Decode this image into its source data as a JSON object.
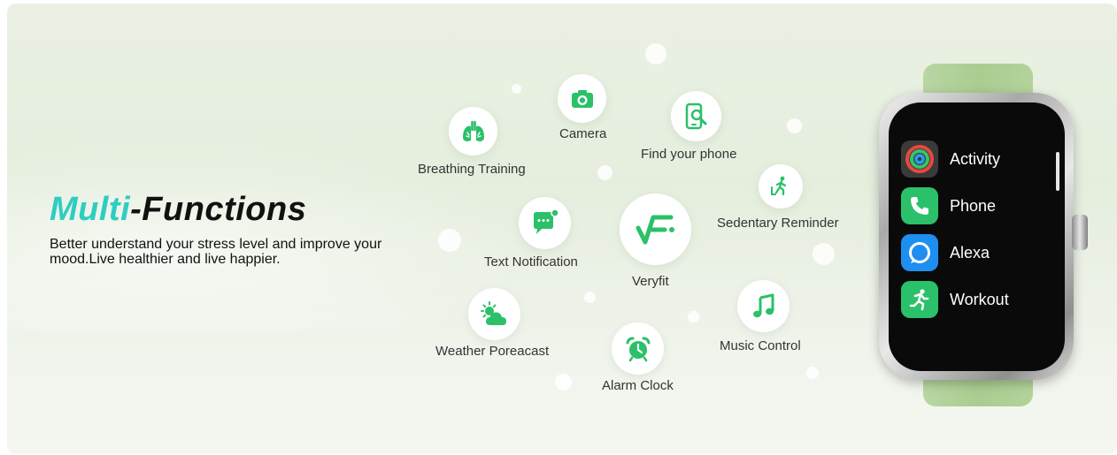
{
  "headline": {
    "part1": "Multi",
    "part2": "-Functions"
  },
  "description": "Better understand your stress level and improve your mood.Live healthier and live happier.",
  "features": {
    "breathing": "Breathing Training",
    "camera": "Camera",
    "find_phone": "Find your phone",
    "sedentary": "Sedentary Reminder",
    "text_notification": "Text Notification",
    "veryfit": "Veryfit",
    "weather": "Weather Poreacast",
    "alarm": "Alarm Clock",
    "music": "Music Control"
  },
  "watch": {
    "apps": [
      {
        "label": "Activity",
        "icon": "activity-rings-icon"
      },
      {
        "label": "Phone",
        "icon": "phone-icon"
      },
      {
        "label": "Alexa",
        "icon": "alexa-icon"
      },
      {
        "label": "Workout",
        "icon": "running-figure-icon"
      }
    ]
  },
  "colors": {
    "accent_teal": "#2fcdc1",
    "icon_green": "#2bc06a",
    "strap_green": "#aacd91",
    "alexa_blue": "#1d8ff0"
  }
}
